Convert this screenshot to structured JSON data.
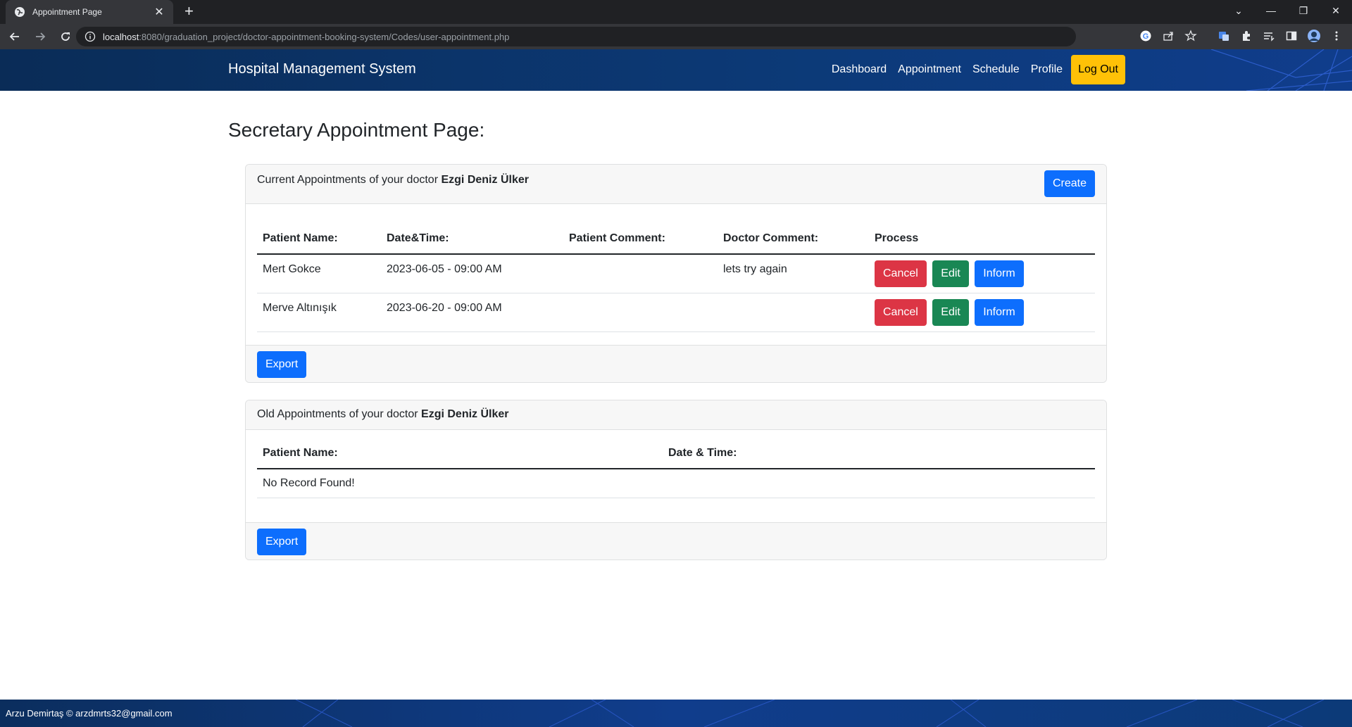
{
  "browser": {
    "tab_title": "Appointment Page",
    "url_host": "localhost",
    "url_rest": ":8080/graduation_project/doctor-appointment-booking-system/Codes/user-appointment.php"
  },
  "navbar": {
    "brand": "Hospital Management System",
    "links": [
      "Dashboard",
      "Appointment",
      "Schedule",
      "Profile"
    ],
    "logout": "Log Out",
    "accent_color": "#ffc107"
  },
  "page": {
    "title": "Secretary Appointment Page:"
  },
  "current_card": {
    "header_prefix": "Current Appointments of your doctor",
    "doctor_name": "Ezgi Deniz Ülker",
    "create_label": "Create",
    "columns": [
      "Patient Name:",
      "Date&Time:",
      "Patient Comment:",
      "Doctor Comment:",
      "Process"
    ],
    "rows": [
      {
        "patient": "Mert Gokce",
        "datetime": "2023-06-05 - 09:00 AM",
        "patient_comment": "",
        "doctor_comment": "lets try again"
      },
      {
        "patient": "Merve Altınışık",
        "datetime": "2023-06-20 - 09:00 AM",
        "patient_comment": "",
        "doctor_comment": ""
      }
    ],
    "actions": {
      "cancel": "Cancel",
      "edit": "Edit",
      "inform": "Inform"
    },
    "export_label": "Export"
  },
  "old_card": {
    "header_prefix": "Old Appointments of your doctor",
    "doctor_name": "Ezgi Deniz Ülker",
    "columns": [
      "Patient Name:",
      "Date & Time:"
    ],
    "empty_message": "No Record Found!",
    "export_label": "Export"
  },
  "footer": {
    "text": "Arzu Demirtaş © arzdmrts32@gmail.com"
  }
}
